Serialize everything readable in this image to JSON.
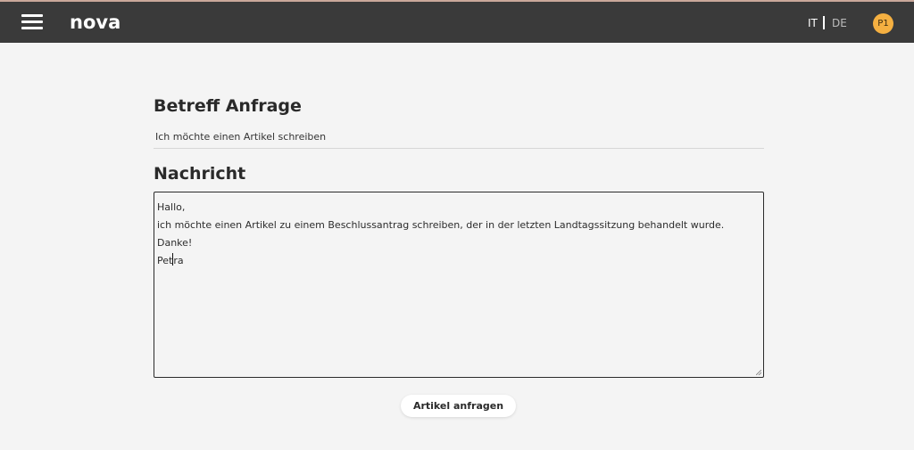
{
  "header": {
    "logo": "nova",
    "languages": [
      {
        "code": "IT",
        "active": true
      },
      {
        "code": "DE",
        "active": false
      }
    ],
    "avatar_initials": "P1",
    "colors": {
      "bar": "#3a3a3a",
      "avatar": "#f5b041"
    },
    "menu_icon": "hamburger-menu-icon"
  },
  "form": {
    "subject_heading": "Betreff Anfrage",
    "subject_value": "Ich möchte einen Artikel schreiben",
    "message_heading": "Nachricht",
    "message_lines": [
      "Hallo,",
      "ich möchte einen Artikel zu einem Beschlussantrag schreiben, der in der letzten Landtagssitzung behandelt wurde.",
      "Danke!"
    ],
    "message_last_line_before_caret": "Pet",
    "message_last_line_after_caret": "ra",
    "submit_label": "Artikel anfragen"
  }
}
